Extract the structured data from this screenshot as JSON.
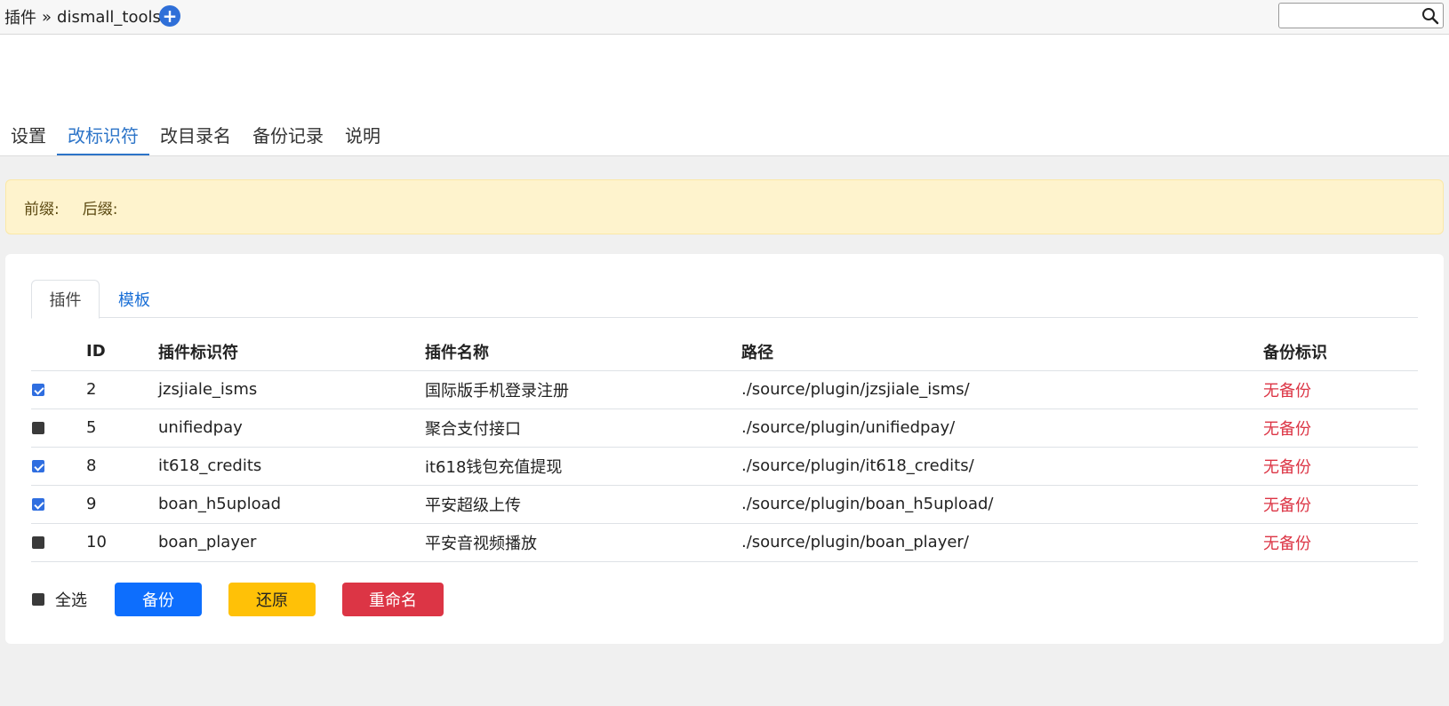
{
  "breadcrumb": {
    "root": "插件",
    "separator": "»",
    "current": "dismall_tools"
  },
  "add_button": {
    "icon": "plus-circle-icon",
    "label": "+"
  },
  "search": {
    "placeholder": "",
    "value": "",
    "icon": "search-icon"
  },
  "main_tabs": [
    {
      "label": "设置",
      "active": false
    },
    {
      "label": "改标识符",
      "active": true
    },
    {
      "label": "改目录名",
      "active": false
    },
    {
      "label": "备份记录",
      "active": false
    },
    {
      "label": "说明",
      "active": false
    }
  ],
  "notice": {
    "prefix_label": "前缀:",
    "suffix_label": "后缀:"
  },
  "sub_tabs": [
    {
      "label": "插件",
      "active": true
    },
    {
      "label": "模板",
      "active": false
    }
  ],
  "table": {
    "headers": [
      "",
      "ID",
      "插件标识符",
      "插件名称",
      "路径",
      "备份标识"
    ],
    "rows": [
      {
        "checked": true,
        "id": "2",
        "identifier": "jzsjiale_isms",
        "name": "国际版手机登录注册",
        "path": "./source/plugin/jzsjiale_isms/",
        "backup": "无备份"
      },
      {
        "checked": false,
        "id": "5",
        "identifier": "unifiedpay",
        "name": "聚合支付接口",
        "path": "./source/plugin/unifiedpay/",
        "backup": "无备份"
      },
      {
        "checked": true,
        "id": "8",
        "identifier": "it618_credits",
        "name": "it618钱包充值提现",
        "path": "./source/plugin/it618_credits/",
        "backup": "无备份"
      },
      {
        "checked": true,
        "id": "9",
        "identifier": "boan_h5upload",
        "name": "平安超级上传",
        "path": "./source/plugin/boan_h5upload/",
        "backup": "无备份"
      },
      {
        "checked": false,
        "id": "10",
        "identifier": "boan_player",
        "name": "平安音视频播放",
        "path": "./source/plugin/boan_player/",
        "backup": "无备份"
      }
    ]
  },
  "footer": {
    "select_all_label": "全选",
    "select_all_checked": false,
    "backup_label": "备份",
    "restore_label": "还原",
    "rename_label": "重命名"
  },
  "colors": {
    "accent": "#2c74c8",
    "primary": "#0d6efd",
    "warning": "#ffc107",
    "danger": "#dc3545",
    "notice_bg": "#fef3cd"
  }
}
